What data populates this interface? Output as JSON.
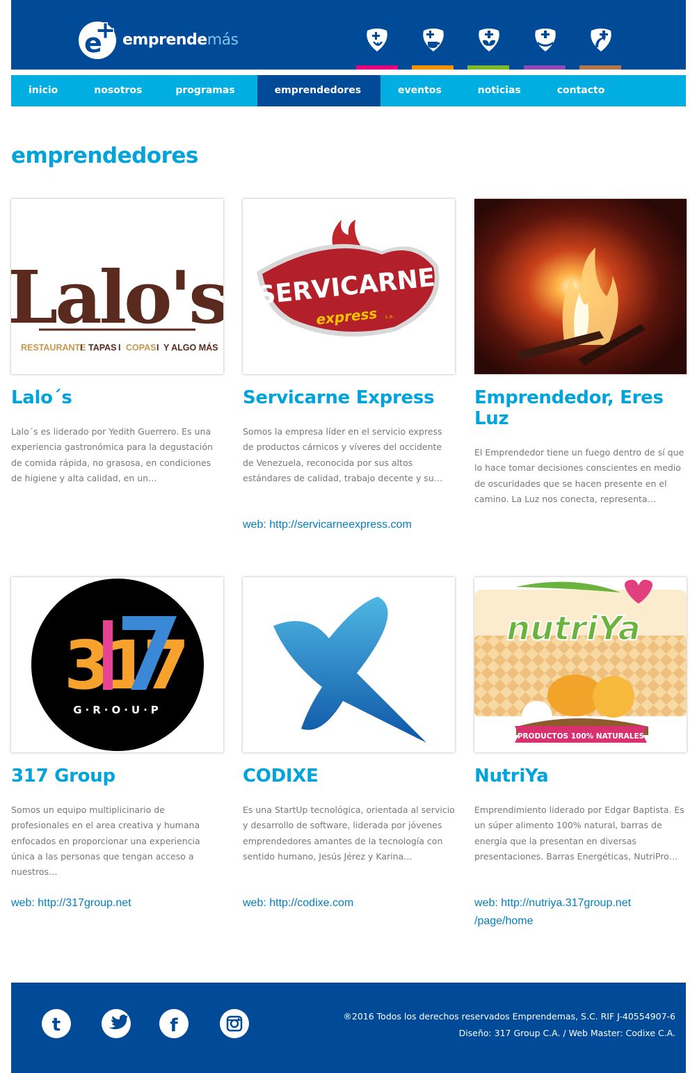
{
  "header": {
    "logo_text_main": "emprende",
    "logo_text_accent": "más",
    "program_icons": [
      {
        "icon": "hand-plus-icon",
        "bar_color": "#e6007e"
      },
      {
        "icon": "cup-plus-icon",
        "bar_color": "#f39200"
      },
      {
        "icon": "leaf-plus-icon",
        "bar_color": "#7ab929"
      },
      {
        "icon": "hands-plus-icon",
        "bar_color": "#8f49b4"
      },
      {
        "icon": "arrow-plus-icon",
        "bar_color": "#b0784a"
      }
    ]
  },
  "nav": {
    "items": [
      {
        "label": "inicio"
      },
      {
        "label": "nosotros"
      },
      {
        "label": "programas"
      },
      {
        "label": "emprendedores"
      },
      {
        "label": "eventos"
      },
      {
        "label": "noticias"
      },
      {
        "label": "contacto"
      }
    ],
    "active": "emprendedores"
  },
  "page": {
    "title": "emprendedores"
  },
  "entrepreneurs": [
    {
      "name": "Lalo´s",
      "logo_text": "Lalo's",
      "logo_tagline": [
        "RESTAURANTE",
        "TAPAS",
        "COPAS",
        "Y ALGO MÁS"
      ],
      "description": "Lalo´s es liderado por Yedith Guerrero. Es una experiencia gastronómica para la degustación de comida rápida, no grasosa, en condiciones de higiene y alta calidad, en un…",
      "web": ""
    },
    {
      "name": "Servicarne Express",
      "logo_text": "SERVICARNE",
      "logo_sub": "express",
      "logo_ca": "c.a.",
      "description": "Somos la empresa líder en el servicio express de productos cárnicos y víveres del occidente de Venezuela, reconocida por sus altos estándares de calidad, trabajo decente y su…",
      "web": "web: http://servicarneexpress.com"
    },
    {
      "name": "Emprendedor, Eres Luz",
      "description": "El Emprendedor tiene un fuego dentro de sí que lo hace tomar decisiones conscientes en medio de oscuridades que se hacen presente en el camino. La Luz nos conecta, representa…",
      "web": ""
    },
    {
      "name": "317 Group",
      "logo_number": "317",
      "logo_word": "G·R·O·U·P",
      "description": "Somos un equipo multiplicinario de profesionales en el area creativa y humana enfocados en proporcionar una experiencia única a las personas que tengan acceso a nuestros…",
      "web": "web: http://317group.net"
    },
    {
      "name": "CODIXE",
      "description": "Es una StartUp tecnológica, orientada al servicio y desarrollo de software, liderada por jóvenes emprendedores amantes de la tecnología con sentido humano, Jesús Jérez y Karina…",
      "web": "web: http://codixe.com"
    },
    {
      "name": "NutriYa",
      "logo_text": "nutriYa",
      "logo_banner": "PRODUCTOS 100% NATURALES",
      "description": "Emprendimiento liderado por Edgar Baptista. Es un súper alimento 100% natural, barras de energía que la presentan en diversas presentaciones. Barras Energéticas, NutriPro…",
      "web_line1": "web: http://nutriya.317group.net",
      "web_line2": "/page/home"
    }
  ],
  "footer": {
    "social": [
      "tumblr-icon",
      "twitter-icon",
      "facebook-icon",
      "instagram-icon"
    ],
    "copyright": "®2016 Todos los derechos reservados Emprendemas, S.C. RIF J-40554907-6",
    "credits": "Diseño: 317 Group C.A. / Web Master: Codixe C.A."
  },
  "colors": {
    "header_blue": "#004a97",
    "nav_cyan": "#00aee2",
    "title_cyan": "#00a3dc",
    "link_blue": "#007fbf"
  }
}
